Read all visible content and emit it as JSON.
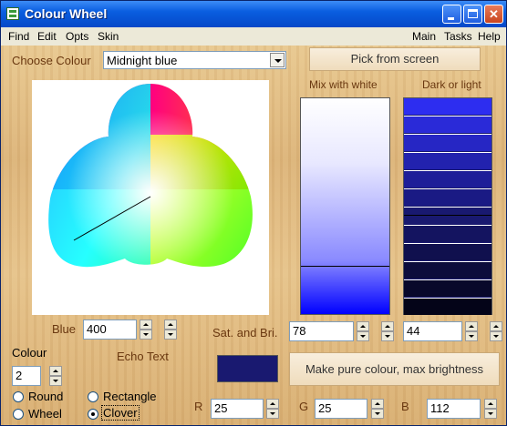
{
  "window": {
    "title": "Colour Wheel"
  },
  "menu": {
    "left": [
      "Find",
      "Edit",
      "Opts",
      "Skin"
    ],
    "right": [
      "Main",
      "Tasks",
      "Help"
    ]
  },
  "choose": {
    "label": "Choose Colour",
    "selected": "Midnight blue"
  },
  "pick_button": "Pick from screen",
  "mix_label": "Mix with white",
  "dark_label": "Dark or light",
  "blue": {
    "label": "Blue",
    "value": "400"
  },
  "satbri": {
    "label": "Sat. and Bri.",
    "sat": "78",
    "bri": "44"
  },
  "colour_count": {
    "label": "Colour",
    "value": "2"
  },
  "echo_label": "Echo Text",
  "shape": {
    "round": "Round",
    "rectangle": "Rectangle",
    "wheel": "Wheel",
    "clover": "Clover",
    "selected": "clover"
  },
  "make_pure_button": "Make pure colour, max brightness",
  "rgb": {
    "r_label": "R",
    "r": "25",
    "g_label": "G",
    "g": "25",
    "b_label": "B",
    "b": "112"
  },
  "colors": {
    "current": "#191970",
    "title_bar": "#0a5ee0",
    "label_brown": "#6a3810"
  },
  "icons": [
    "app-icon",
    "minimize-icon",
    "maximize-icon",
    "close-icon",
    "dropdown-arrow-icon",
    "spin-up-icon",
    "spin-down-icon"
  ]
}
